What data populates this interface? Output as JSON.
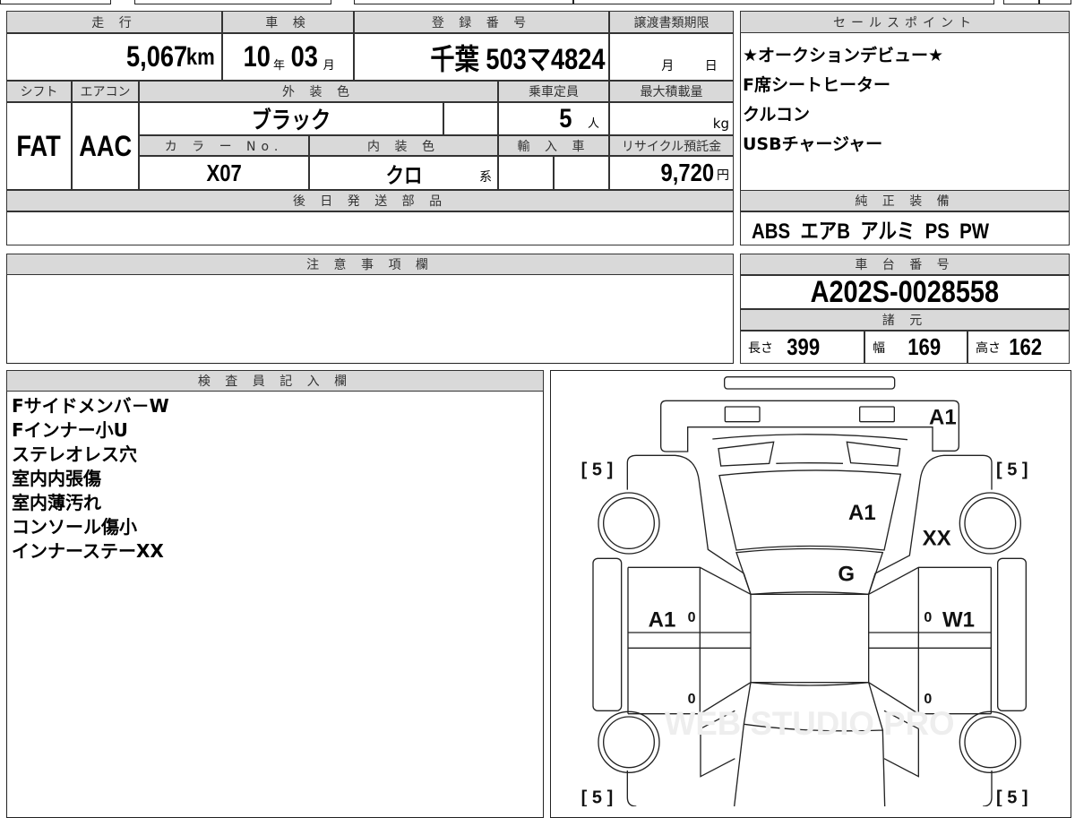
{
  "grid": {
    "mileage": {
      "label": "走 行",
      "value": "5,067",
      "unit": "km"
    },
    "inspection": {
      "label": "車 検",
      "year": "10",
      "year_unit": "年",
      "month": "03",
      "month_unit": "月"
    },
    "registration": {
      "label": "登 録 番 号",
      "value": "千葉 503マ4824"
    },
    "transfer_deadline": {
      "label": "譲渡書類期限",
      "month_unit": "月",
      "day_unit": "日"
    },
    "shift": {
      "label": "シフト",
      "value": "FAT"
    },
    "aircon": {
      "label": "エアコン",
      "value": "AAC"
    },
    "exterior_color": {
      "label": "外 装 色",
      "value": "ブラック"
    },
    "capacity": {
      "label": "乗車定員",
      "value": "5",
      "unit": "人"
    },
    "max_load": {
      "label": "最大積載量",
      "unit": "kg"
    },
    "color_no": {
      "label": "カ ラ ー No.",
      "value": "X07"
    },
    "interior_color": {
      "label": "内 装 色",
      "value": "クロ",
      "unit": "系"
    },
    "import": {
      "label": "輸 入 車"
    },
    "recycle": {
      "label": "リサイクル預託金",
      "value": "9,720",
      "unit": "円"
    },
    "later_parts": {
      "label": "後 日 発 送 部 品"
    }
  },
  "sales_points": {
    "label": "セールスポイント",
    "items": [
      "★オークションデビュー★",
      "F席シートヒーター",
      "クルコン",
      "USBチャージャー"
    ]
  },
  "equipment": {
    "label": "純 正 装 備",
    "value": "ABS  エアB  アルミ  PS  PW"
  },
  "notes": {
    "label": "注 意 事 項 欄"
  },
  "chassis": {
    "label": "車 台 番 号",
    "value": "A202S-0028558"
  },
  "specs": {
    "label": "諸 元",
    "length_label": "長さ",
    "length": "399",
    "width_label": "幅",
    "width": "169",
    "height_label": "高さ",
    "height": "162"
  },
  "inspector": {
    "label": "検 査 員 記 入 欄",
    "items": [
      "Fサイドメンバ－W",
      "Fインナー小U",
      "ステレオレス穴",
      "室内内張傷",
      "室内薄汚れ",
      "コンソール傷小",
      "インナーステーXX"
    ]
  },
  "diagram": {
    "marks": {
      "rear_bumper": "A1",
      "roof": "A1",
      "right_quarter": "XX",
      "rear_glass": "G",
      "left_door": "A1",
      "right_door": "W1"
    },
    "door_counts": [
      "0",
      "0",
      "0",
      "0"
    ],
    "tires": [
      "[ 5 ]",
      "[ 5 ]",
      "[ 5 ]",
      "[ 5 ]"
    ],
    "watermark": "WEB STUDIO PRO"
  }
}
